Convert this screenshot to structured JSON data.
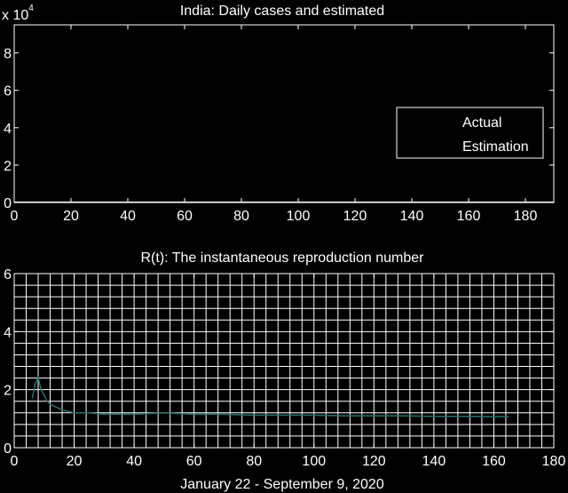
{
  "chart_data": [
    {
      "type": "line",
      "title": "India: Daily cases and estimated",
      "exponent_label": "x 10",
      "exponent_power": "4",
      "xlim": [
        0,
        190
      ],
      "ylim": [
        0,
        9.5
      ],
      "xticks": [
        "0",
        "20",
        "40",
        "60",
        "80",
        "100",
        "120",
        "140",
        "160",
        "180"
      ],
      "xtick_values": [
        0,
        20,
        40,
        60,
        80,
        100,
        120,
        140,
        160,
        180
      ],
      "yticks": [
        "0",
        "2",
        "4",
        "6",
        "8"
      ],
      "ytick_values": [
        0,
        2,
        4,
        6,
        8
      ],
      "grid": false,
      "legend_position": "right",
      "series": [
        {
          "name": "Actual",
          "color": "#ffffff",
          "x": [
            0,
            190
          ],
          "y": [
            0.02,
            0.02
          ]
        },
        {
          "name": "Estimation",
          "color": "#ffffff",
          "x": [],
          "y": []
        }
      ]
    },
    {
      "type": "line",
      "title": "R(t): The instantaneous reproduction number",
      "xlabel": "January 22 - September 9, 2020",
      "xlim": [
        0,
        180
      ],
      "ylim": [
        0,
        6
      ],
      "xticks": [
        "0",
        "20",
        "40",
        "60",
        "80",
        "100",
        "120",
        "140",
        "160",
        "180"
      ],
      "xtick_values": [
        0,
        20,
        40,
        60,
        80,
        100,
        120,
        140,
        160,
        180
      ],
      "yticks": [
        "0",
        "2",
        "4",
        "6"
      ],
      "ytick_values": [
        0,
        2,
        4,
        6
      ],
      "grid": true,
      "grid_step_x": 4,
      "grid_step_y": 0.4,
      "series": [
        {
          "color": "#2a6f6a",
          "x": [
            6,
            7,
            8,
            9,
            10,
            11,
            12,
            14,
            16,
            20,
            25,
            30,
            40,
            50,
            60,
            70,
            80,
            90,
            100,
            110,
            120,
            130,
            140,
            150,
            160,
            165
          ],
          "y": [
            1.7,
            2.2,
            2.4,
            2.0,
            1.8,
            1.6,
            1.5,
            1.4,
            1.3,
            1.2,
            1.2,
            1.15,
            1.15,
            1.2,
            1.15,
            1.15,
            1.12,
            1.12,
            1.12,
            1.1,
            1.1,
            1.1,
            1.08,
            1.08,
            1.07,
            1.07
          ]
        }
      ]
    }
  ]
}
